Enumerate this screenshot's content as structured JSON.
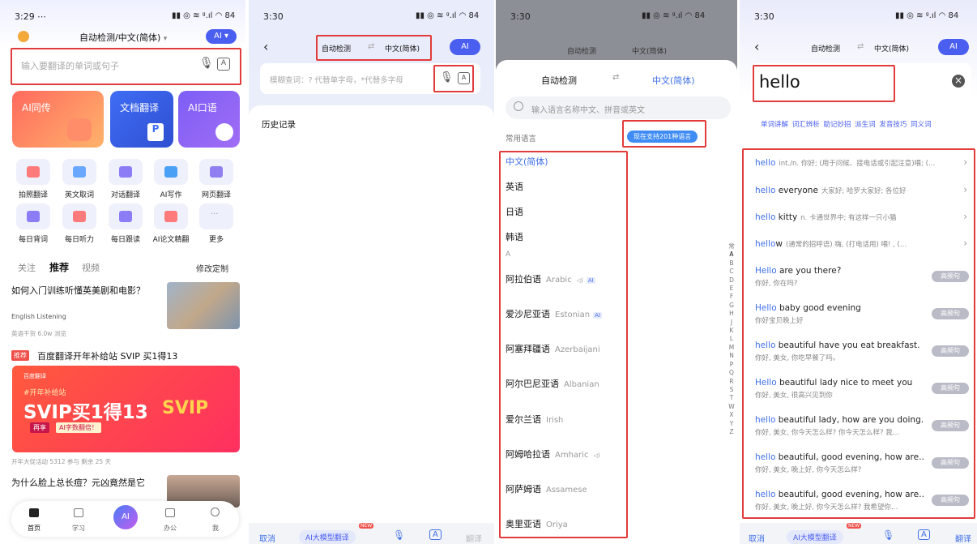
{
  "p1": {
    "time": "3:29",
    "status_icons": "⋯",
    "status_right": "▮▮ ◎ ≋ ᵍ.ıl ◠ 84",
    "title": "自动检测/中文(简体)",
    "title_arrow": "▾",
    "ai_pill": "AI ▾",
    "search_placeholder": "输入要翻译的单词或句子",
    "cards": [
      "AI同传",
      "文档翻译",
      "AI口语"
    ],
    "tools": [
      "拍照翻译",
      "英文取词",
      "对话翻译",
      "AI写作",
      "网页翻译",
      "每日背词",
      "每日听力",
      "每日跟读",
      "AI论文精翻",
      "更多"
    ],
    "more_glyph": "···",
    "tabs": [
      "关注",
      "推荐",
      "视频"
    ],
    "edit_custom": "修改定制",
    "article1_title": "如何入门训练听懂英美剧和电影？",
    "article1_tag": "English Listening",
    "article1_meta": "英语干货  6.0w 浏览",
    "promo_badge": "推荐",
    "promo_title": "百度翻译开年补给站 SVIP 买1得13",
    "banner_brand": "百度翻译",
    "banner_hashtag": "#开年补给站",
    "banner_main": "SVIP买1得13",
    "banner_sub1": "再享",
    "banner_sub2": "AI字数翻倍！",
    "banner_svip": "SVIP",
    "promo_meta": "开年大促活动  5312 参与  剩余 25 天",
    "article2_title": "为什么脸上总长痘？元凶竟然是它",
    "nav": [
      "首页",
      "学习",
      "",
      "办公",
      "我"
    ],
    "nav_ai": "AI"
  },
  "p2": {
    "time": "3:30",
    "status_right": "▮▮ ◎ ≋ ᵍ.ıl ◠ 84",
    "source_lang": "自动检测",
    "target_lang": "中文(简体)",
    "swap": "⇄",
    "ai_pill": "AI",
    "placeholder": "模糊查词：? 代替单字母，*代替多字母",
    "history_label": "历史记录",
    "bottom": [
      "取消",
      "AI大模型翻译",
      "",
      "",
      "翻译"
    ],
    "new_badge": "NEW"
  },
  "p3": {
    "time": "3:30",
    "status_right": "▮▮ ◎ ≋ ᵍ.ıl ◠ 84",
    "header_source": "自动检测",
    "header_target": "中文(简体)",
    "swap": "⇄",
    "search_placeholder": "输入语言名称中文、拼音或英文",
    "common_label": "常用语言",
    "support_pill": "现在支持201种语言",
    "common_langs": [
      "中文(简体)",
      "英语",
      "日语",
      "韩语"
    ],
    "section_a": "A",
    "ai_badge": "AI",
    "speaker": "◁)",
    "langs": [
      {
        "zh": "阿拉伯语",
        "en": "Arabic"
      },
      {
        "zh": "爱沙尼亚语",
        "en": "Estonian"
      },
      {
        "zh": "阿塞拜疆语",
        "en": "Azerbaijani"
      },
      {
        "zh": "阿尔巴尼亚语",
        "en": "Albanian"
      },
      {
        "zh": "爱尔兰语",
        "en": "Irish"
      },
      {
        "zh": "阿姆哈拉语",
        "en": "Amharic"
      },
      {
        "zh": "阿萨姆语",
        "en": "Assamese"
      },
      {
        "zh": "奥里亚语",
        "en": "Oriya"
      }
    ],
    "alphabet": [
      "常",
      "A",
      "B",
      "C",
      "D",
      "E",
      "F",
      "G",
      "H",
      "J",
      "K",
      "L",
      "M",
      "N",
      "P",
      "Q",
      "R",
      "S",
      "T",
      "W",
      "X",
      "Y",
      "Z"
    ]
  },
  "p4": {
    "time": "3:30",
    "status_right": "▮▮ ◎ ≋ ᵍ.ıl ◠ 84",
    "source_lang": "自动检测",
    "target_lang": "中文(简体)",
    "swap": "⇄",
    "ai_pill": "AI",
    "query": "hello",
    "clear": "×",
    "chips": [
      "单词讲解",
      "词汇辨析",
      "助记妙招",
      "派生词",
      "发音技巧",
      "同义词"
    ],
    "word_suggestions": [
      {
        "hl": "hello",
        "rest": "",
        "tr": "int./n. 你好; (用于问候、接电话或引起注意)喂; (…"
      },
      {
        "hl": "hello",
        "rest": " everyone",
        "tr": "大家好; 哈罗大家好; 各位好"
      },
      {
        "hl": "hello",
        "rest": " kitty",
        "tr": "n. 卡通世界中; 有这样一只小猫"
      },
      {
        "hl": "hello",
        "rest": "w",
        "tr": "(通常的招呼语) 嗨, (打电话用) 喂! ,  (…"
      }
    ],
    "sentences": [
      {
        "hl": "Hello",
        "rest": " are you there?",
        "sub": "你好, 你在吗?"
      },
      {
        "hl": "Hello",
        "rest": " baby good evening",
        "sub": "你好宝贝晚上好"
      },
      {
        "hl": "hello",
        "rest": " beautiful have you eat breakfast.",
        "sub": "你好, 美女, 你吃早餐了吗。"
      },
      {
        "hl": "Hello",
        "rest": " beautiful lady nice to meet you",
        "sub": "你好, 美女, 很高兴见到你"
      },
      {
        "hl": "hello",
        "rest": " beautiful lady, how are you doing…",
        "sub": "你好, 美女, 你今天怎么样? 你今天怎么样? 我…"
      },
      {
        "hl": "hello",
        "rest": " beautiful, good evening, how are…",
        "sub": "你好, 美女, 晚上好, 你今天怎么样?"
      },
      {
        "hl": "hello",
        "rest": " beautiful, good evening, how are…",
        "sub": "你好, 美女, 晚上好, 你今天怎么样? 我希望你…"
      }
    ],
    "hf_label": "高频句",
    "bottom": [
      "取消",
      "AI大模型翻译",
      "",
      "",
      "翻译"
    ],
    "new_badge": "NEW"
  }
}
